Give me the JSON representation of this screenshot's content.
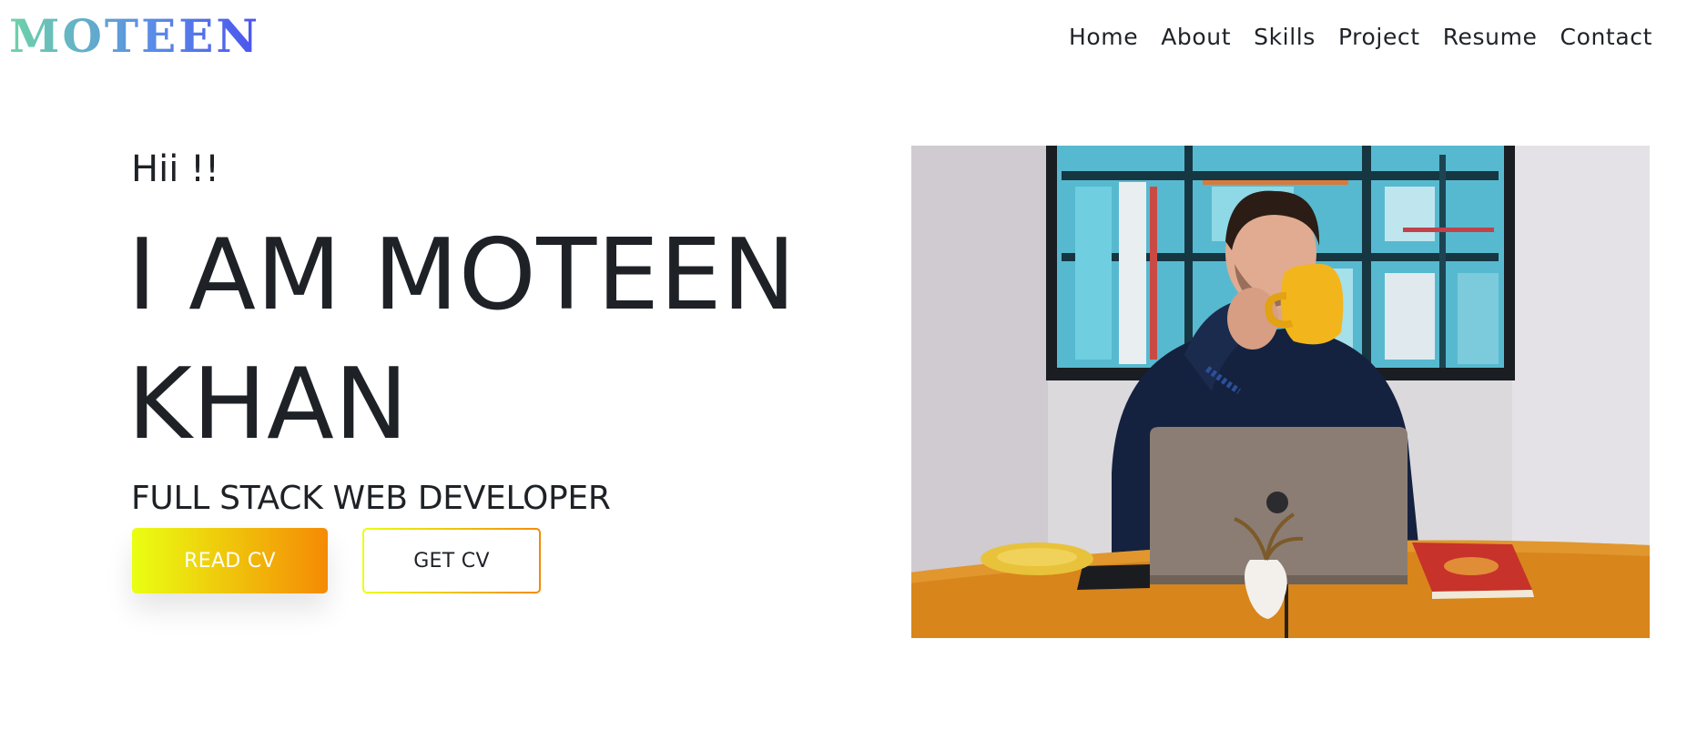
{
  "navbar": {
    "brand": "MOTEEN",
    "links": [
      "Home",
      "About",
      "Skills",
      "Project",
      "Resume",
      "Contact"
    ]
  },
  "hero": {
    "greeting": "Hii !!",
    "title_line1": "I AM MOTEEN",
    "title_line2": "KHAN",
    "subtitle": "FULL STACK WEB DEVELOPER",
    "read_cv_label": "READ CV",
    "get_cv_label": "GET CV"
  },
  "colors": {
    "brand_gradient_start": "#6fd3a8",
    "brand_gradient_end": "#4b53ee",
    "button_gradient_start": "#eaff12",
    "button_gradient_end": "#f58a05",
    "text": "#1e2227"
  },
  "icons": {
    "hero_image": "man-drinking-coffee-at-laptop-photo"
  }
}
